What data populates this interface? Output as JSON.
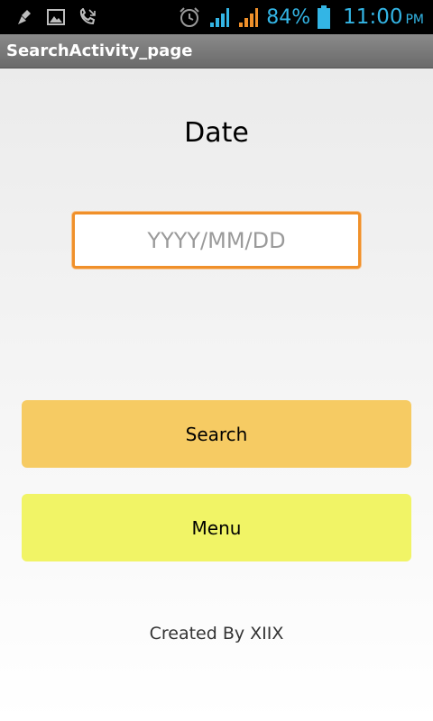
{
  "status_bar": {
    "icons": [
      "cleanup-icon",
      "image-icon",
      "missed-call-icon",
      "alarm-icon",
      "signal-icon",
      "signal-icon-2",
      "battery-icon"
    ],
    "battery": "84%",
    "time": "11:00",
    "ampm": "PM",
    "accent_color": "#33b5e5"
  },
  "title_bar": {
    "title": "SearchActivity_page"
  },
  "main": {
    "date_label": "Date",
    "date_input": {
      "placeholder": "YYYY/MM/DD",
      "value": ""
    },
    "search_button": {
      "label": "Search",
      "color": "#f6cb63"
    },
    "menu_button": {
      "label": "Menu",
      "color": "#f1f466"
    },
    "footer": "Created By XIIX"
  }
}
